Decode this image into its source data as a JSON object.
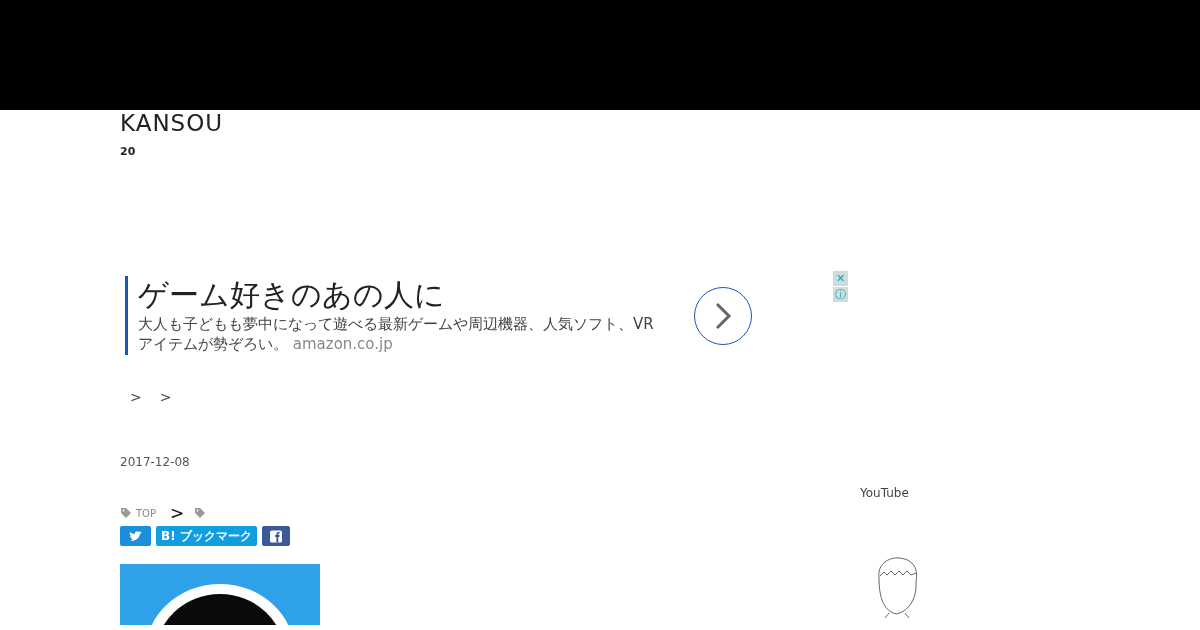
{
  "blog": {
    "title": "KANSOU",
    "subtitle": "20"
  },
  "ad": {
    "headline": "ゲーム好きのあの人に",
    "body": "大人も子どもも夢中になって遊べる最新ゲームや周辺機器、人気ソフト、VRアイテムが勢ぞろい。",
    "domain": "amazon.co.jp",
    "close_glyph": "✕",
    "info_glyph": "ⓘ"
  },
  "breadcrumb": [
    ">",
    ">"
  ],
  "entry": {
    "date": "2017-12-08",
    "category": "TOP",
    "category_sep": ">",
    "share": [
      {
        "kind": "twitter"
      },
      {
        "kind": "hatena",
        "label": "B! ブックマーク"
      },
      {
        "kind": "facebook"
      }
    ]
  },
  "sidebar": {
    "heading": "YouTube"
  }
}
